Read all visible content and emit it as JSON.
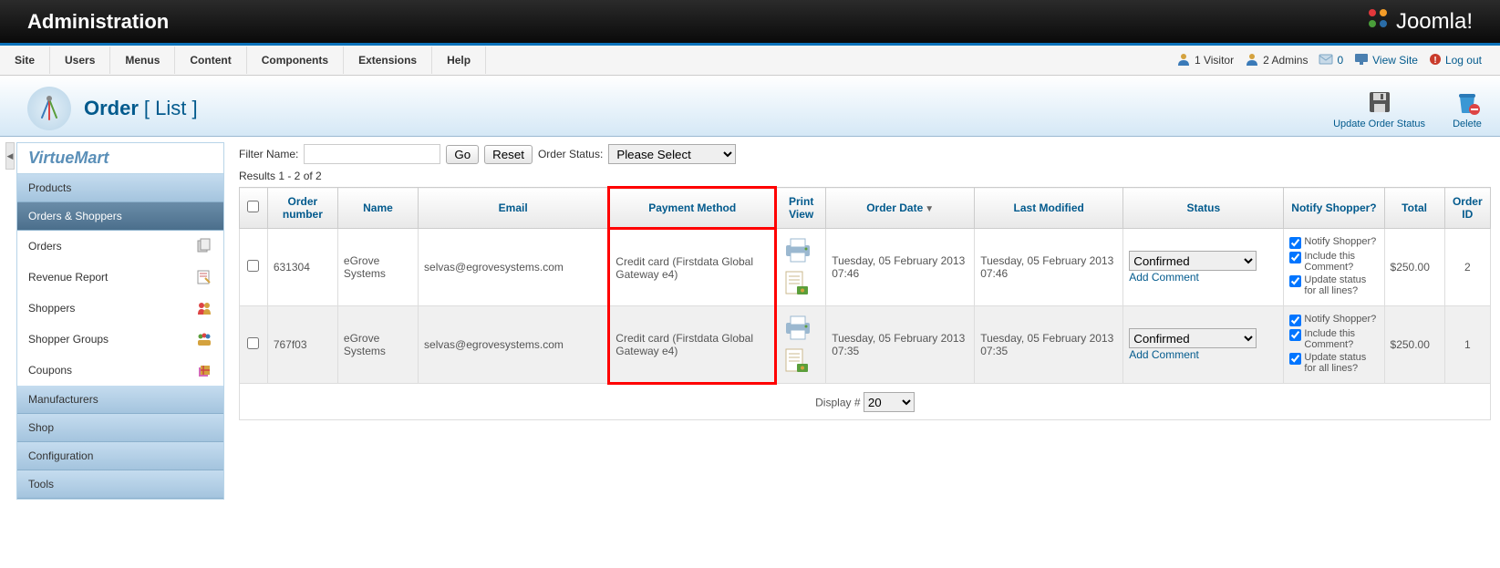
{
  "header": {
    "title": "Administration",
    "logo_text": "Joomla!"
  },
  "top_menu": {
    "items": [
      "Site",
      "Users",
      "Menus",
      "Content",
      "Components",
      "Extensions",
      "Help"
    ],
    "visitors_count": "1 Visitor",
    "admins_count": "2 Admins",
    "messages_count": "0",
    "view_site": "View Site",
    "log_out": "Log out"
  },
  "page": {
    "title": "Order",
    "subtitle": "[ List ]"
  },
  "toolbar": {
    "update": "Update Order Status",
    "delete": "Delete"
  },
  "sidebar": {
    "logo": "VirtueMart",
    "sections": {
      "products": "Products",
      "orders_shoppers": "Orders & Shoppers",
      "manufacturers": "Manufacturers",
      "shop": "Shop",
      "configuration": "Configuration",
      "tools": "Tools"
    },
    "sub_items": [
      "Orders",
      "Revenue Report",
      "Shoppers",
      "Shopper Groups",
      "Coupons"
    ]
  },
  "filter": {
    "label": "Filter Name:",
    "go": "Go",
    "reset": "Reset",
    "status_label": "Order Status:",
    "status_placeholder": "Please Select",
    "results": "Results 1 - 2 of 2"
  },
  "columns": {
    "checkbox": "",
    "order_number": "Order number",
    "name": "Name",
    "email": "Email",
    "payment_method": "Payment Method",
    "print_view": "Print View",
    "order_date": "Order Date",
    "last_modified": "Last Modified",
    "status": "Status",
    "notify_shopper": "Notify Shopper?",
    "total": "Total",
    "order_id": "Order ID"
  },
  "rows": [
    {
      "order_number": "631304",
      "name": "eGrove Systems",
      "email": "selvas@egrovesystems.com",
      "payment_method": "Credit card (Firstdata Global Gateway e4)",
      "order_date": "Tuesday, 05 February 2013 07:46",
      "last_modified": "Tuesday, 05 February 2013 07:46",
      "status": "Confirmed",
      "add_comment": "Add Comment",
      "notify_shopper": "Notify Shopper?",
      "include_comment": "Include this Comment?",
      "update_status": "Update status for all lines?",
      "total": "$250.00",
      "order_id": "2"
    },
    {
      "order_number": "767f03",
      "name": "eGrove Systems",
      "email": "selvas@egrovesystems.com",
      "payment_method": "Credit card (Firstdata Global Gateway e4)",
      "order_date": "Tuesday, 05 February 2013 07:35",
      "last_modified": "Tuesday, 05 February 2013 07:35",
      "status": "Confirmed",
      "add_comment": "Add Comment",
      "notify_shopper": "Notify Shopper?",
      "include_comment": "Include this Comment?",
      "update_status": "Update status for all lines?",
      "total": "$250.00",
      "order_id": "1"
    }
  ],
  "footer": {
    "display_label": "Display #",
    "display_value": "20"
  }
}
